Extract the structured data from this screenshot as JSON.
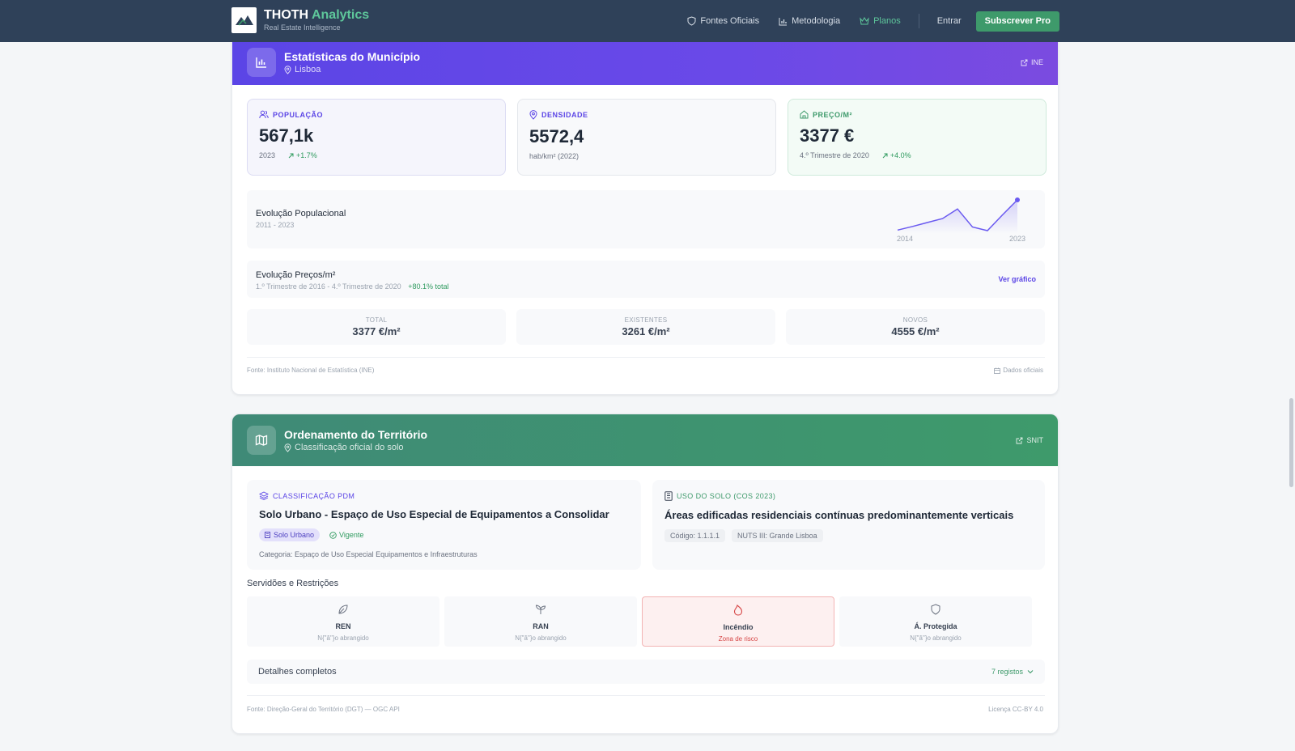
{
  "header": {
    "brand_main": "THOTH",
    "brand_accent": "Analytics",
    "brand_sub": "Real Estate Intelligence",
    "nav": [
      {
        "label": "Fontes Oficiais",
        "icon": "shield-icon"
      },
      {
        "label": "Metodologia",
        "icon": "bar-chart-icon"
      },
      {
        "label": "Planos",
        "icon": "crown-icon",
        "active": true
      }
    ],
    "login_label": "Entrar",
    "cta_label": "Subscrever Pro"
  },
  "stats_card": {
    "title": "Estatísticas do Município",
    "location": "Lisboa",
    "source_link": "INE",
    "population": {
      "label": "POPULAÇÃO",
      "value": "567,1k",
      "year": "2023",
      "trend": "+1.7%"
    },
    "density": {
      "label": "DENSIDADE",
      "value": "5572,4",
      "unit": "hab/km² (2022)"
    },
    "price": {
      "label": "PREÇO/M²",
      "value": "3377 €",
      "period": "4.º Trimestre de 2020",
      "trend": "+4.0%"
    },
    "pop_evolution": {
      "title": "Evolução Populacional",
      "range": "2011 - 2023",
      "axis_start": "2014",
      "axis_end": "2023",
      "sparkline": [
        0.3,
        0.42,
        0.55,
        0.68,
        1.0,
        0.4,
        0.28,
        0.8,
        1.3
      ]
    },
    "price_evolution": {
      "title": "Evolução Preços/m²",
      "range": "1.º Trimestre de 2016 - 4.º Trimestre de 2020",
      "total_change": "+80.1% total",
      "link": "Ver gráfico"
    },
    "prices": [
      {
        "label": "TOTAL",
        "value": "3377 €/m²"
      },
      {
        "label": "EXISTENTES",
        "value": "3261 €/m²"
      },
      {
        "label": "NOVOS",
        "value": "4555 €/m²"
      }
    ],
    "footer_source": "Fonte: Instituto Nacional de Estatística (INE)",
    "footer_badge": "Dados oficiais"
  },
  "territory_card": {
    "title": "Ordenamento do Território",
    "subtitle": "Classificação oficial do solo",
    "source_link": "SNIT",
    "pdm": {
      "label": "CLASSIFICAÇÃO PDM",
      "title": "Solo Urbano - Espaço de Uso Especial de Equipamentos a Consolidar",
      "tag": "Solo Urbano",
      "status": "Vigente",
      "category": "Categoria: Espaço de Uso Especial Equipamentos e Infraestruturas"
    },
    "cos": {
      "label": "USO DO SOLO (COS 2023)",
      "title": "Áreas edificadas residenciais contínuas predominantemente verticais",
      "code": "Código: 1.1.1.1",
      "nuts": "NUTS III: Grande Lisboa"
    },
    "restrictions_title": "Servidões e Restrições",
    "restrictions": [
      {
        "name": "REN",
        "status": "N{\"â\"}o abrangido",
        "icon": "leaf-icon"
      },
      {
        "name": "RAN",
        "status": "N{\"â\"}o abrangido",
        "icon": "sprout-icon"
      },
      {
        "name": "Incêndio",
        "status": "Zona de risco",
        "icon": "flame-icon"
      },
      {
        "name": "Á. Protegida",
        "status": "N{\"â\"}o abrangido",
        "icon": "shield-icon"
      }
    ],
    "details_title": "Detalhes completos",
    "details_count": "7 registos",
    "footer_source": "Fonte: Direção-Geral do Território (DGT) — OGC API",
    "footer_license": "Licença CC-BY 4.0"
  },
  "colors": {
    "header_bg": "#2f4159",
    "accent_green": "#3e9a6b",
    "purple": "#5b45e6",
    "risk_red": "#d64545"
  }
}
